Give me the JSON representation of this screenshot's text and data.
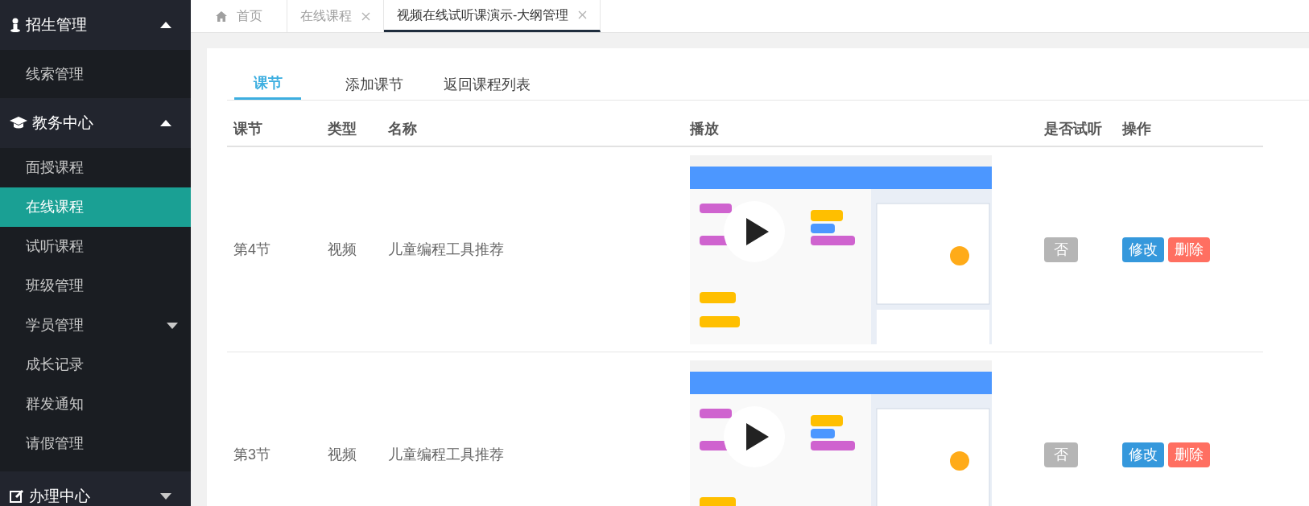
{
  "sidebar": {
    "sections": [
      {
        "label": "招生管理",
        "kind": "person",
        "expanded": true,
        "items": [
          {
            "label": "线索管理",
            "selected": false
          }
        ]
      },
      {
        "label": "教务中心",
        "kind": "cap",
        "expanded": true,
        "items": [
          {
            "label": "面授课程",
            "selected": false
          },
          {
            "label": "在线课程",
            "selected": true
          },
          {
            "label": "试听课程",
            "selected": false
          },
          {
            "label": "班级管理",
            "selected": false
          },
          {
            "label": "学员管理",
            "selected": false,
            "expanded": false
          },
          {
            "label": "成长记录",
            "selected": false
          },
          {
            "label": "群发通知",
            "selected": false
          },
          {
            "label": "请假管理",
            "selected": false
          }
        ]
      },
      {
        "label": "办理中心",
        "kind": "edit",
        "expanded": false
      }
    ]
  },
  "page_tabs": [
    {
      "label": "首页",
      "kind": "home",
      "selected": false
    },
    {
      "label": "在线课程",
      "kind": "closable",
      "selected": false
    },
    {
      "label": "视频在线试听课演示-大纲管理",
      "kind": "closable",
      "selected": true
    }
  ],
  "content_tabs": [
    {
      "label": "课节",
      "selected": true
    },
    {
      "label": "添加课节",
      "selected": false
    },
    {
      "label": "返回课程列表",
      "selected": false
    }
  ],
  "table": {
    "columns": [
      "课节",
      "类型",
      "名称",
      "播放",
      "是否试听",
      "操作"
    ],
    "rows": [
      {
        "section": "第4节",
        "type": "视频",
        "name": "儿童编程工具推荐",
        "trial": "否",
        "trial_on": false,
        "edit": "修改",
        "delete": "删除"
      },
      {
        "section": "第3节",
        "type": "视频",
        "name": "儿童编程工具推荐",
        "trial": "否",
        "trial_on": false,
        "edit": "修改",
        "delete": "删除"
      }
    ]
  }
}
